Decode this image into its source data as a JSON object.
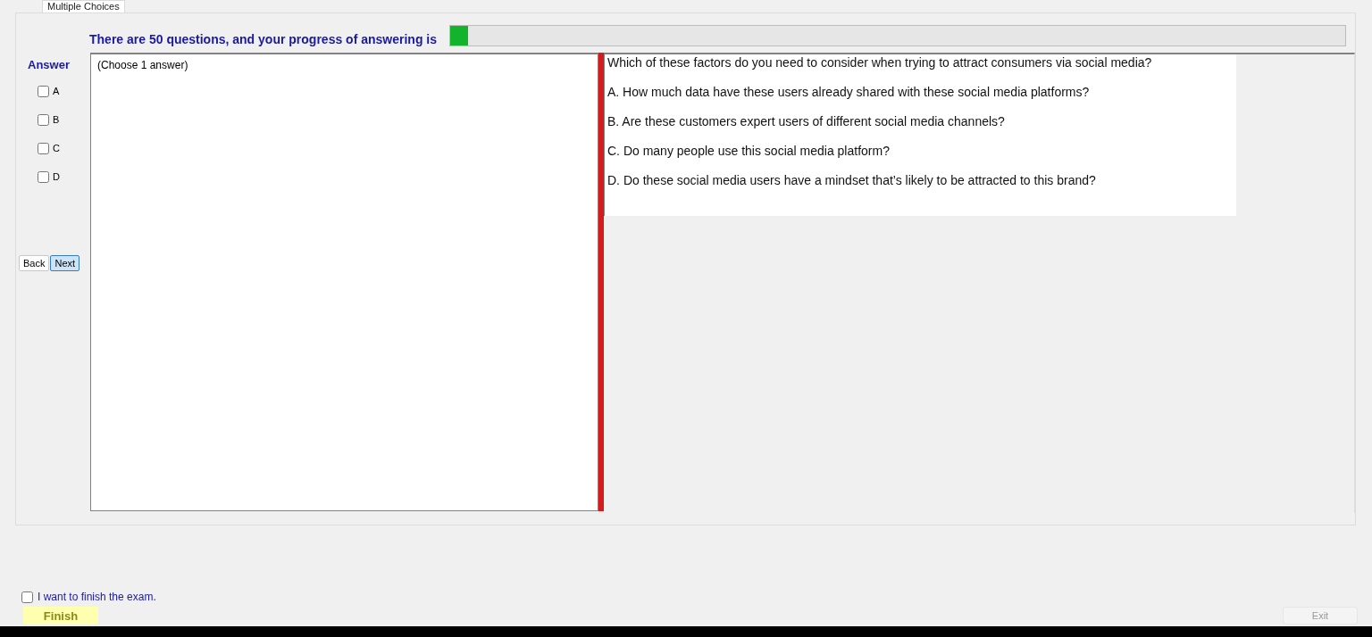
{
  "tab": {
    "label": "Multiple Choices"
  },
  "heading": "There are 50 questions, and your progress of answering is",
  "progress": {
    "level": 0.02
  },
  "answer_label": "Answer",
  "options": [
    {
      "label": "A",
      "checked": false
    },
    {
      "label": "B",
      "checked": false
    },
    {
      "label": "C",
      "checked": false
    },
    {
      "label": "D",
      "checked": false
    }
  ],
  "buttons": [
    {
      "label": "Back",
      "kind": "back"
    },
    {
      "label": "Next",
      "kind": "next"
    }
  ],
  "answer_box": "(Choose 1 answer)",
  "question": "Which of these factors do you need to consider when trying to attract consumers via social media?",
  "choices": [
    "A.  How much data have these users already shared with these social media platforms?",
    "B.  Are these customers expert users of different social media channels?",
    "C.  Do many people use this social media platform?",
    "D.  Do these social media users have a mindset that’s likely to be attracted to this brand?"
  ],
  "finish_check": {
    "label": "I want to finish the exam.",
    "checked": false
  },
  "finish_button": "Finish",
  "exit_button": {
    "label": "Exit",
    "disabled": true
  }
}
